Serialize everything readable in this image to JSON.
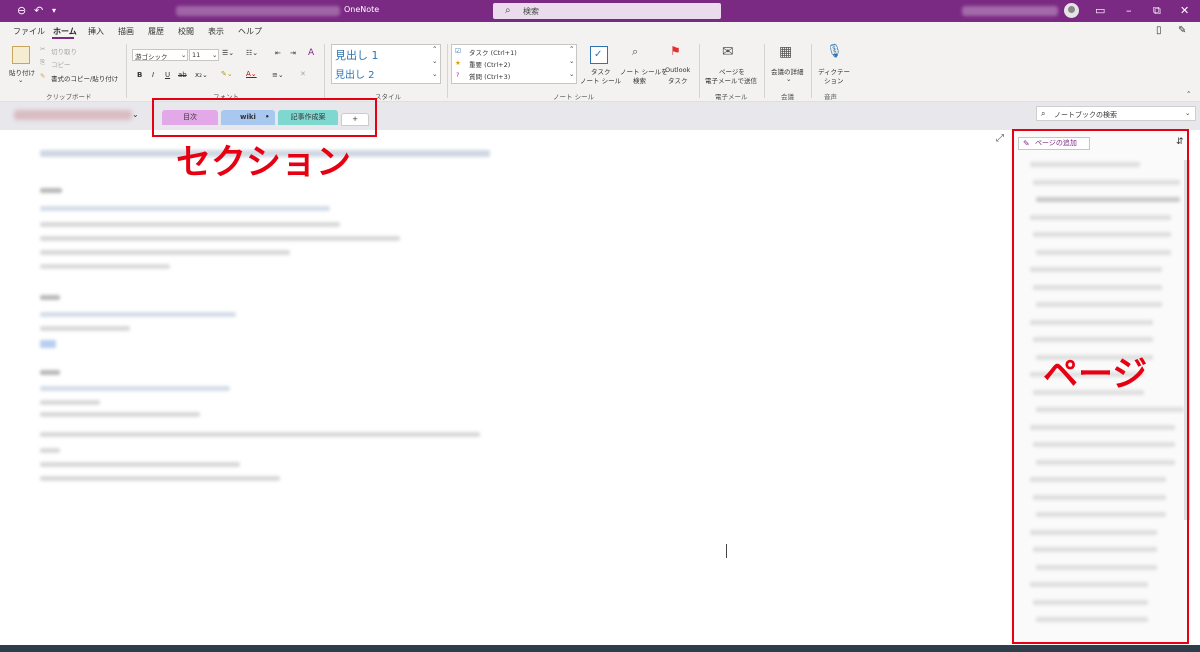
{
  "titlebar": {
    "app_name": "OneNote",
    "search_placeholder": "検索"
  },
  "menu": [
    "ファイル",
    "ホーム",
    "挿入",
    "描画",
    "履歴",
    "校閲",
    "表示",
    "ヘルプ"
  ],
  "clipboard": {
    "paste": "貼り付け",
    "cut": "切り取り",
    "copy": "コピー",
    "format_painter": "書式のコピー/貼り付け",
    "label": "クリップボード"
  },
  "font": {
    "family": "游ゴシック",
    "size": "11",
    "label": "フォント"
  },
  "styles": {
    "h1": "見出し 1",
    "h2": "見出し 2",
    "label": "スタイル"
  },
  "tags": {
    "items": [
      "タスク (Ctrl+1)",
      "重要 (Ctrl+2)",
      "質問 (Ctrl+3)"
    ],
    "task_btn": [
      "タスク",
      "ノート シール"
    ],
    "find_btn": [
      "ノート シールを",
      "検索"
    ],
    "outlook_btn": [
      "Outlook",
      "タスク"
    ],
    "label": "ノート シール"
  },
  "email": {
    "btn": [
      "ページを",
      "電子メールで送信"
    ],
    "label": "電子メール"
  },
  "meeting": {
    "btn": [
      "会議の詳細"
    ],
    "label": "会議"
  },
  "voice": {
    "btn": [
      "ディクテー",
      "ション"
    ],
    "label": "音声"
  },
  "sections": [
    "目次",
    "wiki",
    "記事作成案",
    "+"
  ],
  "notebook_search": "ノートブックの検索",
  "pages": {
    "add_label": "ページの追加"
  },
  "annotations": {
    "sections": "セクション",
    "pages": "ページ"
  },
  "colors": {
    "accent": "#7b2a84",
    "annotation": "#e50012",
    "tab_1": "#e3a8e8",
    "tab_2": "#a8c8f0",
    "tab_3": "#7ed8d0"
  }
}
